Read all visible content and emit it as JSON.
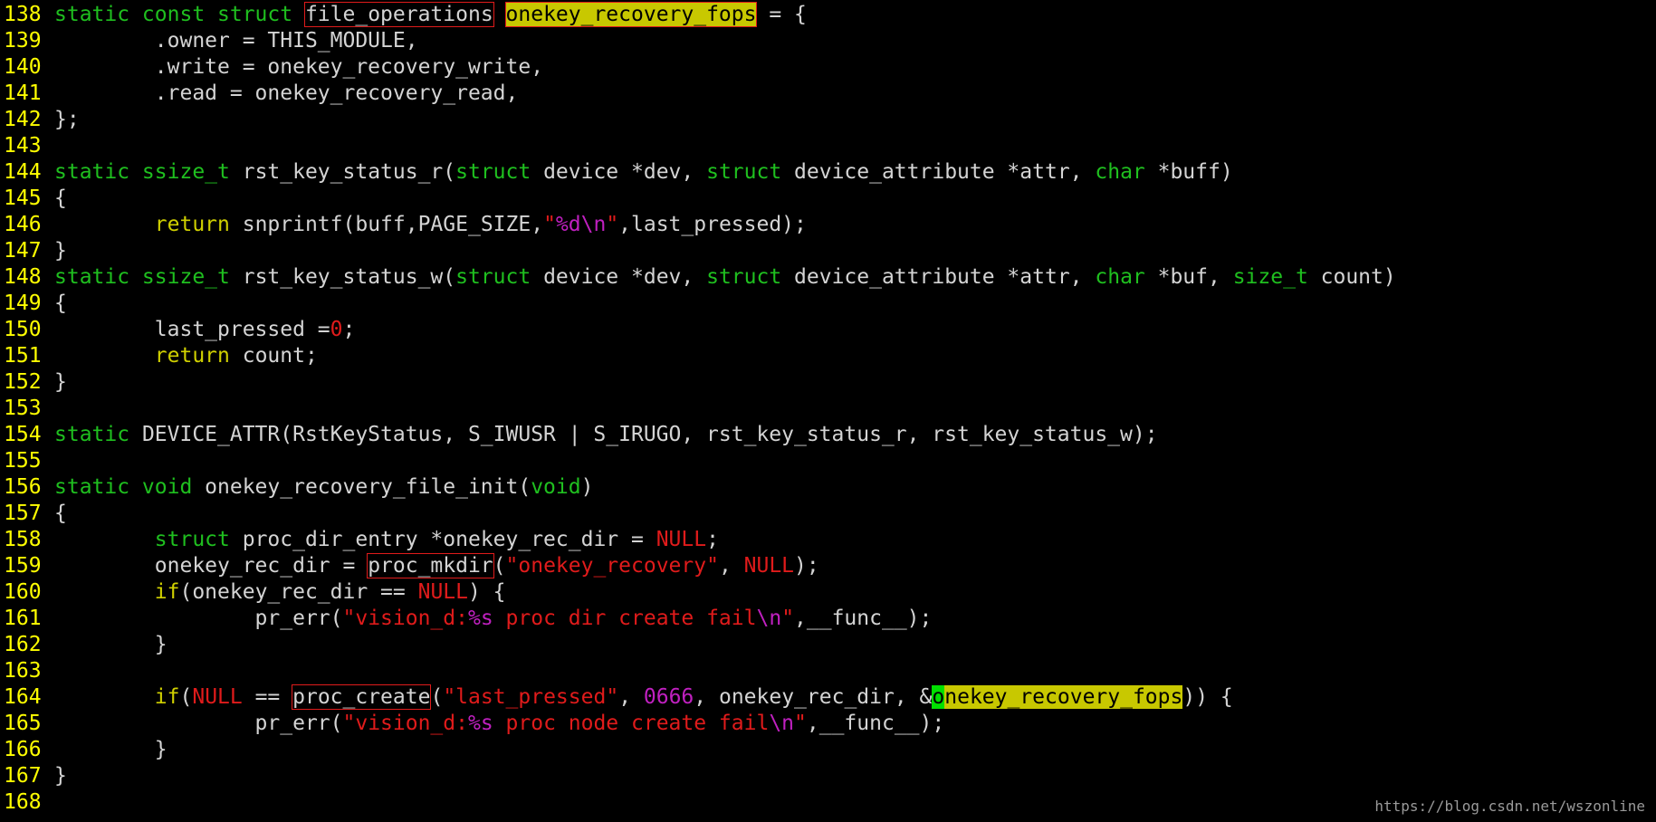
{
  "lines": [
    {
      "n": "138",
      "segs": [
        [
          "static const struct ",
          "kw"
        ],
        [
          "file_operations",
          "box"
        ],
        [
          " ",
          ""
        ],
        [
          "onekey_recovery_fops",
          "hl box"
        ],
        [
          " = {",
          ""
        ]
      ]
    },
    {
      "n": "139",
      "segs": [
        [
          "        .owner = THIS_MODULE,",
          ""
        ]
      ]
    },
    {
      "n": "140",
      "segs": [
        [
          "        .write = onekey_recovery_write,",
          ""
        ]
      ]
    },
    {
      "n": "141",
      "segs": [
        [
          "        .read = onekey_recovery_read,",
          ""
        ]
      ]
    },
    {
      "n": "142",
      "segs": [
        [
          "};",
          ""
        ]
      ]
    },
    {
      "n": "143",
      "segs": []
    },
    {
      "n": "144",
      "segs": [
        [
          "static ssize_t ",
          "kw"
        ],
        [
          "rst_key_status_r(",
          ""
        ],
        [
          "struct",
          "kw"
        ],
        [
          " device *dev, ",
          ""
        ],
        [
          "struct",
          "kw"
        ],
        [
          " device_attribute *attr, ",
          ""
        ],
        [
          "char",
          "kw"
        ],
        [
          " *buff)",
          ""
        ]
      ]
    },
    {
      "n": "145",
      "segs": [
        [
          "{",
          ""
        ]
      ]
    },
    {
      "n": "146",
      "segs": [
        [
          "        ",
          ""
        ],
        [
          "return",
          "kwy"
        ],
        [
          " snprintf(buff,PAGE_SIZE,",
          ""
        ],
        [
          "\"",
          "str"
        ],
        [
          "%d\\n",
          "fmt"
        ],
        [
          "\"",
          "str"
        ],
        [
          ",last_pressed);",
          ""
        ]
      ]
    },
    {
      "n": "147",
      "segs": [
        [
          "}",
          ""
        ]
      ]
    },
    {
      "n": "148",
      "segs": [
        [
          "static ssize_t ",
          "kw"
        ],
        [
          "rst_key_status_w(",
          ""
        ],
        [
          "struct",
          "kw"
        ],
        [
          " device *dev, ",
          ""
        ],
        [
          "struct",
          "kw"
        ],
        [
          " device_attribute *attr, ",
          ""
        ],
        [
          "char",
          "kw"
        ],
        [
          " *buf, ",
          ""
        ],
        [
          "size_t",
          "kw"
        ],
        [
          " count)",
          ""
        ]
      ]
    },
    {
      "n": "149",
      "segs": [
        [
          "{",
          ""
        ]
      ]
    },
    {
      "n": "150",
      "segs": [
        [
          "        last_pressed =",
          ""
        ],
        [
          "0",
          "red"
        ],
        [
          ";",
          ""
        ]
      ]
    },
    {
      "n": "151",
      "segs": [
        [
          "        ",
          ""
        ],
        [
          "return",
          "kwy"
        ],
        [
          " count;",
          ""
        ]
      ]
    },
    {
      "n": "152",
      "segs": [
        [
          "}",
          ""
        ]
      ]
    },
    {
      "n": "153",
      "segs": []
    },
    {
      "n": "154",
      "segs": [
        [
          "static ",
          "kw"
        ],
        [
          "DEVICE_ATTR(RstKeyStatus, S_IWUSR | S_IRUGO, rst_key_status_r, rst_key_status_w);",
          ""
        ]
      ]
    },
    {
      "n": "155",
      "segs": []
    },
    {
      "n": "156",
      "segs": [
        [
          "static void ",
          "kw"
        ],
        [
          "onekey_recovery_file_init(",
          ""
        ],
        [
          "void",
          "kw"
        ],
        [
          ")",
          ""
        ]
      ]
    },
    {
      "n": "157",
      "segs": [
        [
          "{",
          ""
        ]
      ]
    },
    {
      "n": "158",
      "segs": [
        [
          "        ",
          ""
        ],
        [
          "struct",
          "kw"
        ],
        [
          " proc_dir_entry *onekey_rec_dir = ",
          ""
        ],
        [
          "NULL",
          "red"
        ],
        [
          ";",
          ""
        ]
      ]
    },
    {
      "n": "159",
      "segs": [
        [
          "        onekey_rec_dir = ",
          ""
        ],
        [
          "proc_mkdir",
          "box"
        ],
        [
          "(",
          ""
        ],
        [
          "\"onekey_recovery\"",
          "str"
        ],
        [
          ", ",
          ""
        ],
        [
          "NULL",
          "red"
        ],
        [
          ");",
          ""
        ]
      ]
    },
    {
      "n": "160",
      "segs": [
        [
          "        ",
          ""
        ],
        [
          "if",
          "kwy"
        ],
        [
          "(onekey_rec_dir == ",
          ""
        ],
        [
          "NULL",
          "red"
        ],
        [
          ") {",
          ""
        ]
      ]
    },
    {
      "n": "161",
      "segs": [
        [
          "                pr_err(",
          ""
        ],
        [
          "\"vision_d:",
          "str"
        ],
        [
          "%s",
          "fmt"
        ],
        [
          " proc dir create fail",
          "str"
        ],
        [
          "\\n",
          "fmt"
        ],
        [
          "\"",
          "str"
        ],
        [
          ",__func__);",
          ""
        ]
      ]
    },
    {
      "n": "162",
      "segs": [
        [
          "        }",
          ""
        ]
      ]
    },
    {
      "n": "163",
      "segs": []
    },
    {
      "n": "164",
      "segs": [
        [
          "        ",
          ""
        ],
        [
          "if",
          "kwy"
        ],
        [
          "(",
          ""
        ],
        [
          "NULL",
          "red"
        ],
        [
          " == ",
          ""
        ],
        [
          "proc_create",
          "box"
        ],
        [
          "(",
          ""
        ],
        [
          "\"last_pressed\"",
          "str"
        ],
        [
          ", ",
          ""
        ],
        [
          "0666",
          "fmt"
        ],
        [
          ", onekey_rec_dir, &",
          ""
        ],
        [
          "o",
          "cursor"
        ],
        [
          "nekey_recovery_fops",
          "hl"
        ],
        [
          ")) {",
          ""
        ]
      ]
    },
    {
      "n": "165",
      "segs": [
        [
          "                pr_err(",
          ""
        ],
        [
          "\"vision_d:",
          "str"
        ],
        [
          "%s",
          "fmt"
        ],
        [
          " proc node create fail",
          "str"
        ],
        [
          "\\n",
          "fmt"
        ],
        [
          "\"",
          "str"
        ],
        [
          ",__func__);",
          ""
        ]
      ]
    },
    {
      "n": "166",
      "segs": [
        [
          "        }",
          ""
        ]
      ]
    },
    {
      "n": "167",
      "segs": [
        [
          "}",
          ""
        ]
      ]
    },
    {
      "n": "168",
      "segs": []
    }
  ],
  "watermark": "https://blog.csdn.net/wszonline"
}
